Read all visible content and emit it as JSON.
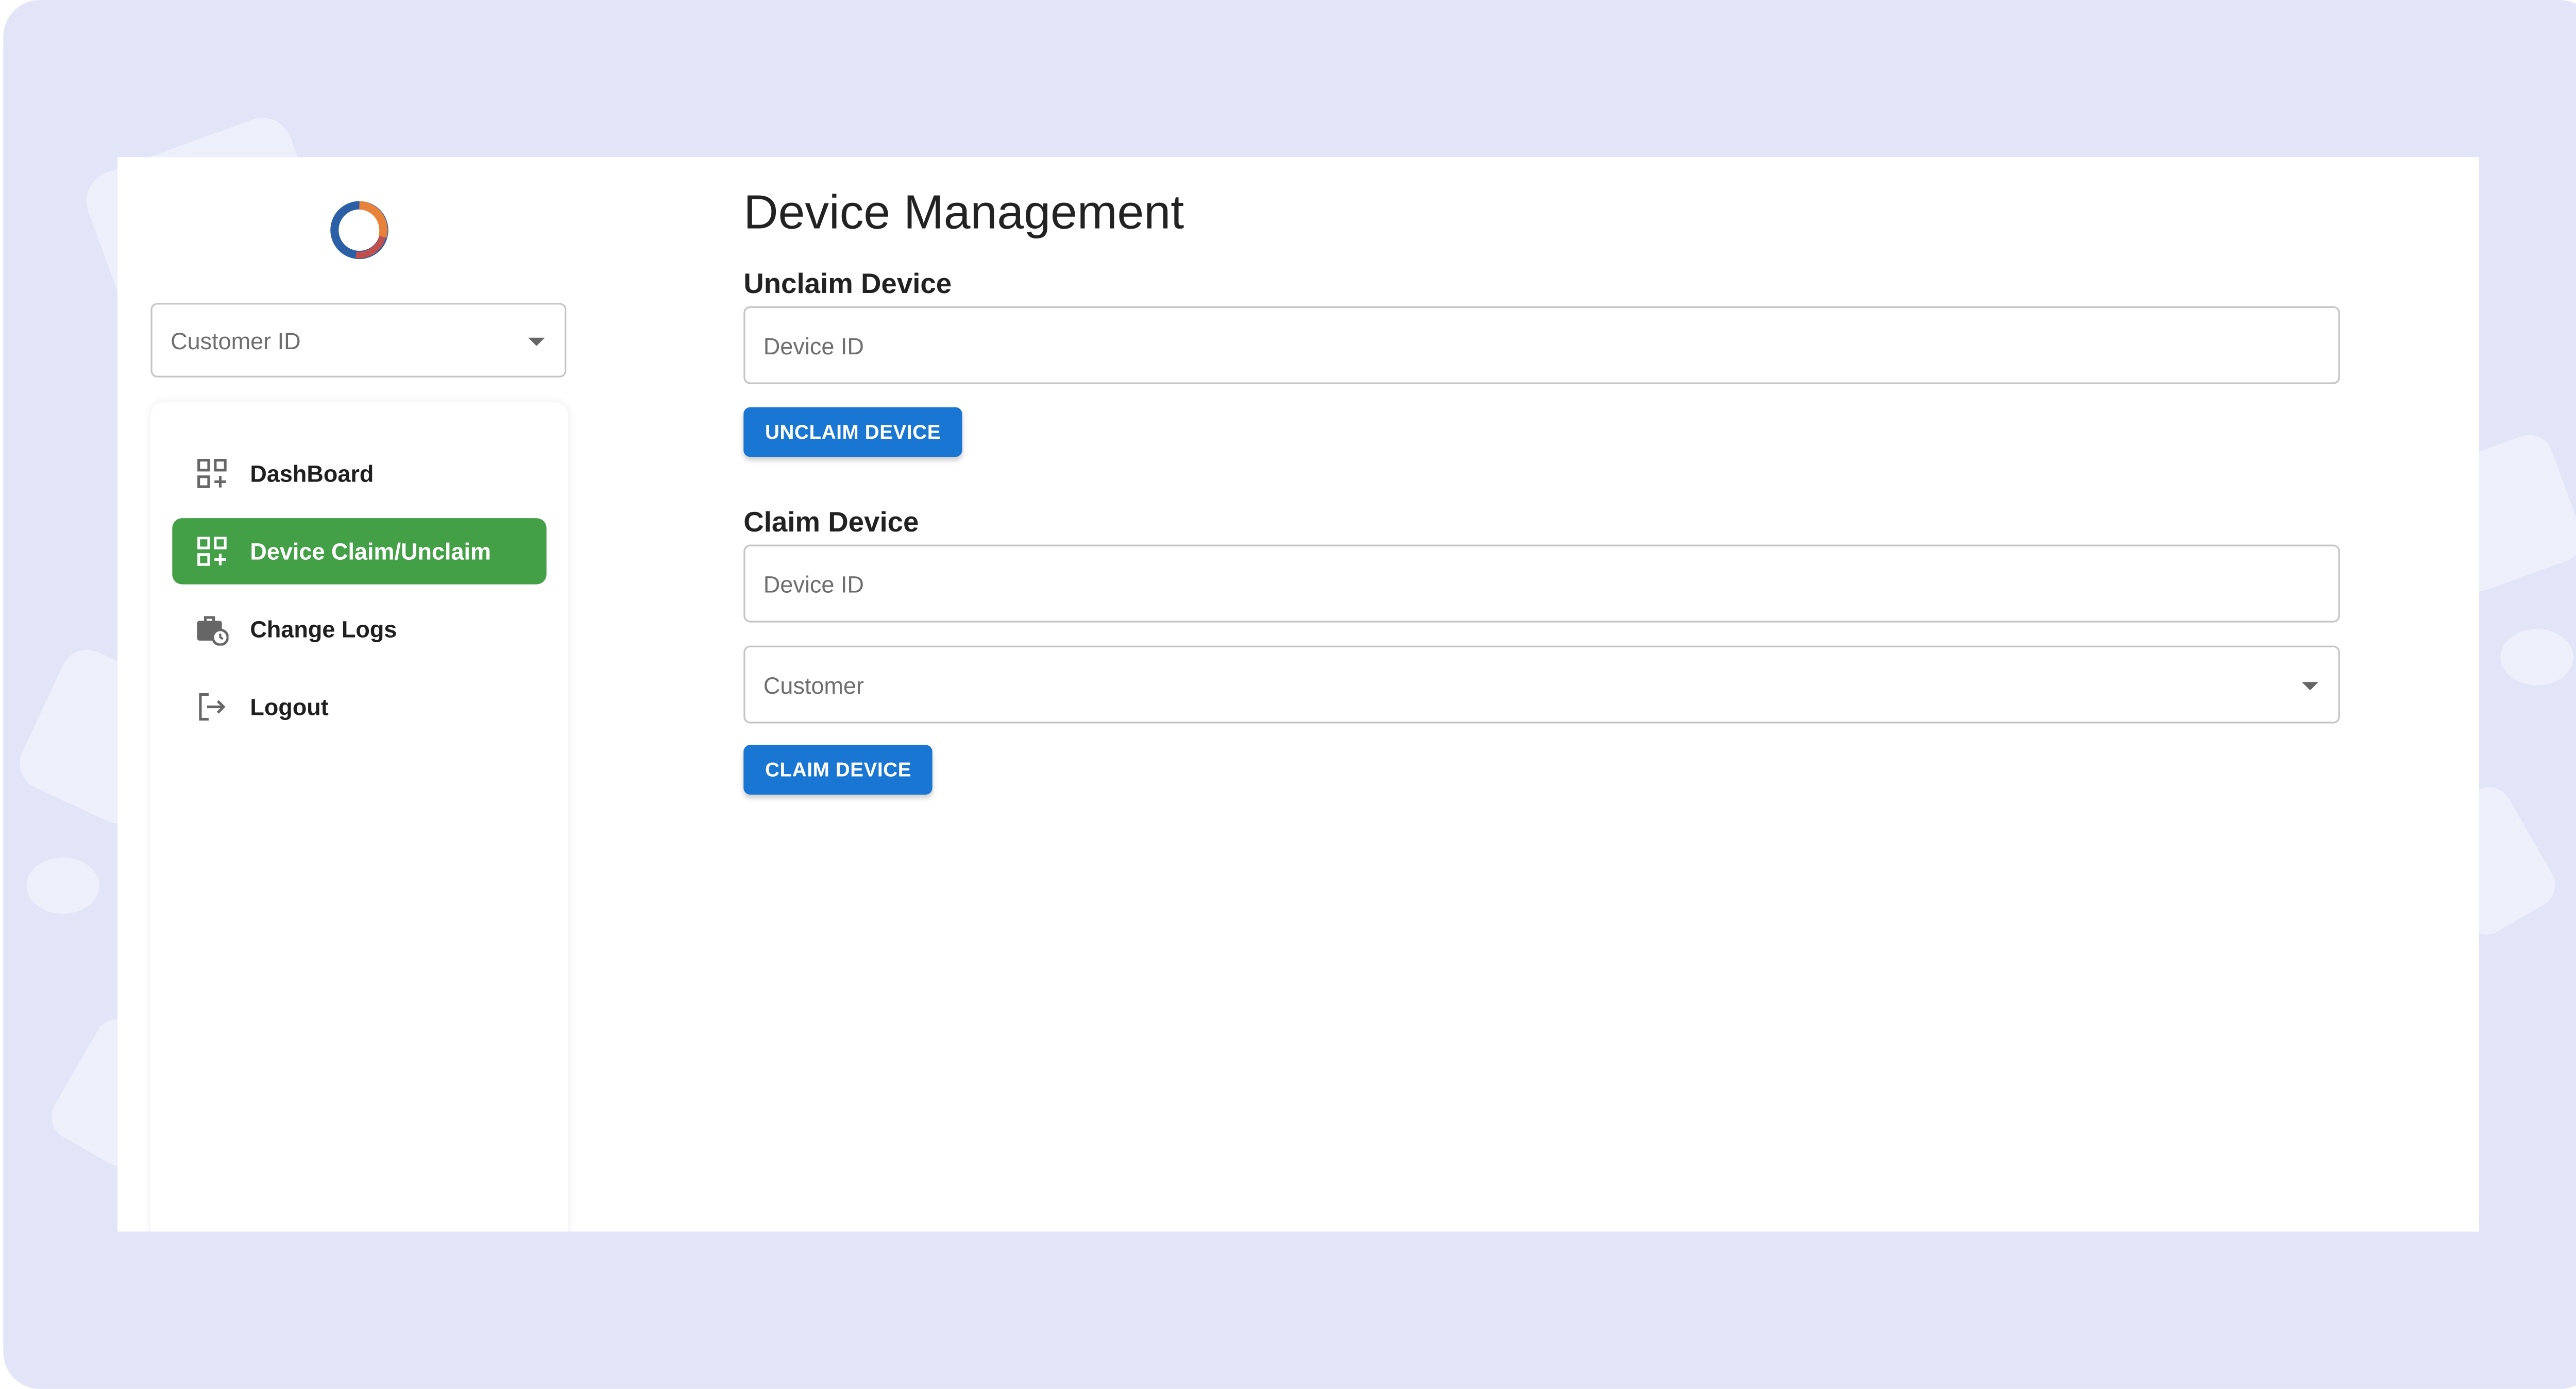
{
  "app": {
    "customer_select_placeholder": "Customer ID"
  },
  "sidebar": {
    "items": [
      {
        "label": "DashBoard",
        "icon": "dashboard-icon",
        "active": false
      },
      {
        "label": "Device Claim/Unclaim",
        "icon": "dashboard-icon",
        "active": true
      },
      {
        "label": "Change Logs",
        "icon": "briefcase-clock-icon",
        "active": false
      },
      {
        "label": "Logout",
        "icon": "logout-icon",
        "active": false
      }
    ]
  },
  "main": {
    "title": "Device Management",
    "unclaim": {
      "heading": "Unclaim Device",
      "device_id_placeholder": "Device ID",
      "button_label": "UNCLAIM DEVICE"
    },
    "claim": {
      "heading": "Claim Device",
      "device_id_placeholder": "Device ID",
      "customer_placeholder": "Customer",
      "button_label": "CLAIM DEVICE"
    }
  },
  "colors": {
    "backdrop": "#e2e5f7",
    "active_nav": "#43a047",
    "primary_button": "#1976d2"
  }
}
